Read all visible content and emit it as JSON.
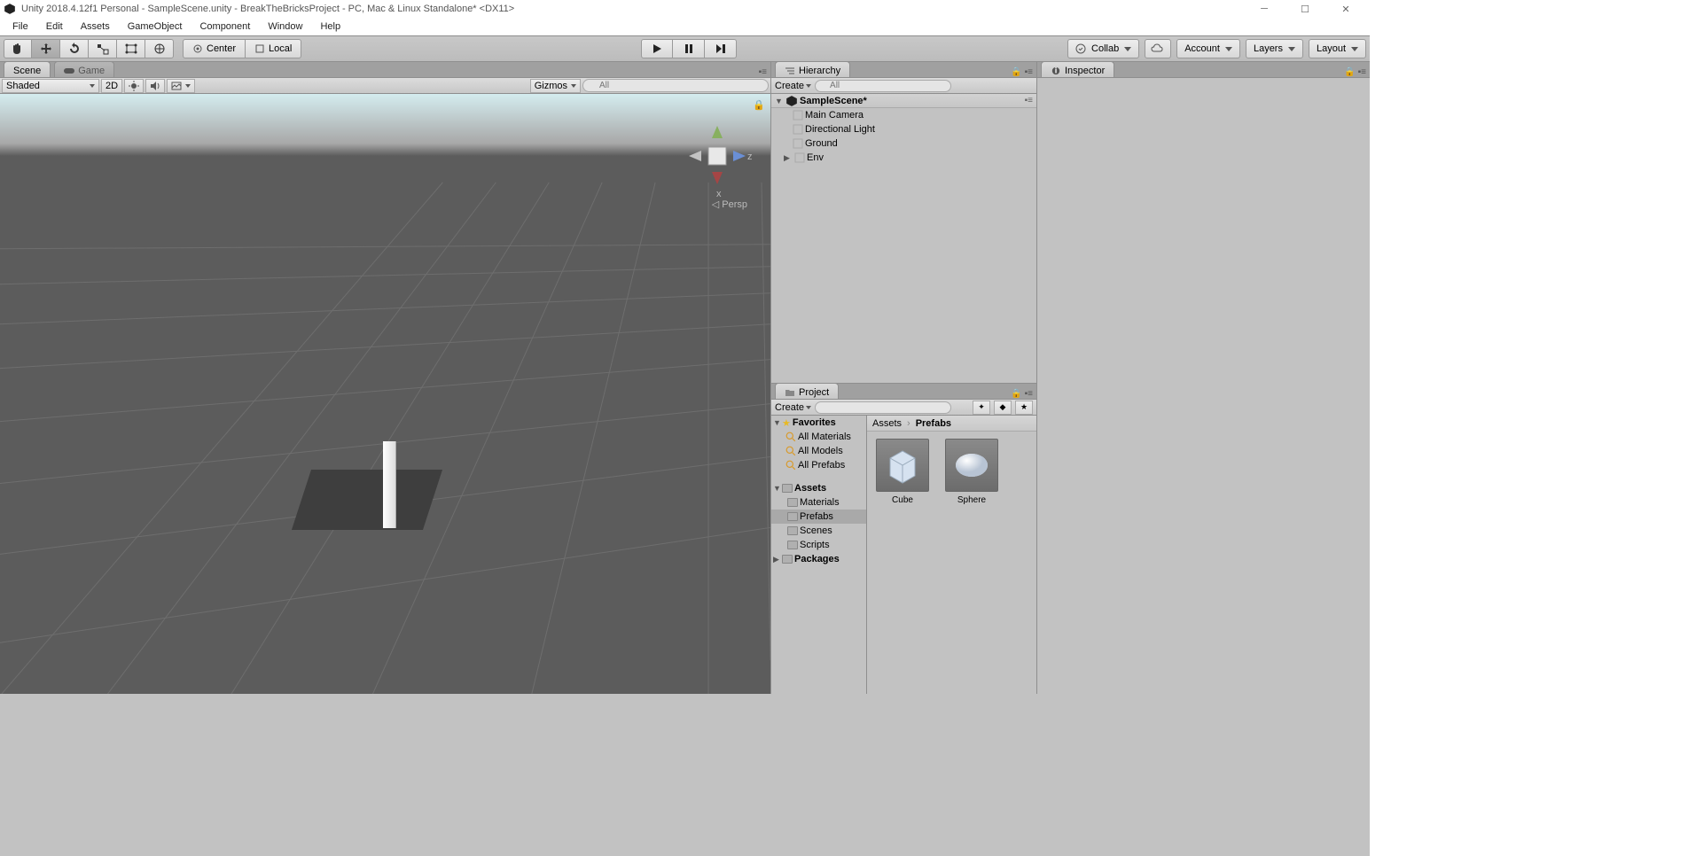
{
  "titlebar": {
    "title": "Unity 2018.4.12f1 Personal - SampleScene.unity - BreakTheBricksProject - PC, Mac & Linux Standalone* <DX11>"
  },
  "menubar": {
    "items": [
      "File",
      "Edit",
      "Assets",
      "GameObject",
      "Component",
      "Window",
      "Help"
    ]
  },
  "toolbar": {
    "center_label": "Center",
    "local_label": "Local",
    "collab_label": "Collab",
    "account_label": "Account",
    "layers_label": "Layers",
    "layout_label": "Layout"
  },
  "tabs": {
    "scene": "Scene",
    "game": "Game",
    "hierarchy": "Hierarchy",
    "project": "Project",
    "inspector": "Inspector"
  },
  "scene_controls": {
    "shaded": "Shaded",
    "two_d": "2D",
    "gizmos": "Gizmos",
    "search_placeholder": "All"
  },
  "viewport": {
    "persp": "Persp",
    "axes": {
      "x": "x",
      "y": "",
      "z": "z"
    }
  },
  "hierarchy": {
    "create": "Create",
    "search_placeholder": "All",
    "scene_name": "SampleScene*",
    "objects": [
      "Main Camera",
      "Directional Light",
      "Ground",
      "Env"
    ]
  },
  "project": {
    "create": "Create",
    "favorites": "Favorites",
    "fav_items": [
      "All Materials",
      "All Models",
      "All Prefabs"
    ],
    "assets": "Assets",
    "folders": [
      "Materials",
      "Prefabs",
      "Scenes",
      "Scripts"
    ],
    "packages": "Packages",
    "breadcrumb_root": "Assets",
    "breadcrumb_current": "Prefabs",
    "assets_list": [
      "Cube",
      "Sphere"
    ]
  }
}
